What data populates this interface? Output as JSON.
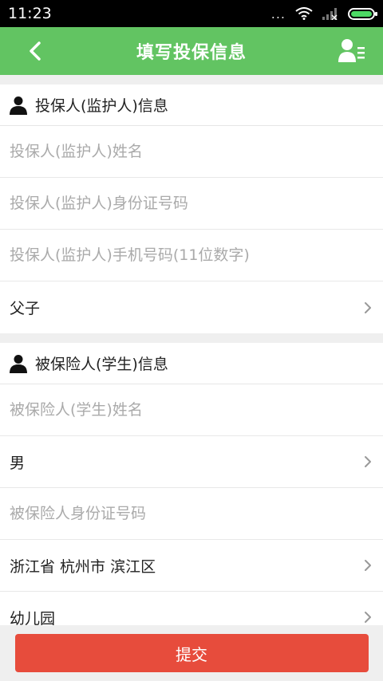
{
  "status_bar": {
    "time": "11:23",
    "dots": "...",
    "battery_level": 1.0
  },
  "nav": {
    "title": "填写投保信息"
  },
  "policyholder": {
    "title": "投保人(监护人)信息",
    "name_placeholder": "投保人(监护人)姓名",
    "id_placeholder": "投保人(监护人)身份证号码",
    "phone_placeholder": "投保人(监护人)手机号码(11位数字)",
    "relation": "父子"
  },
  "insured": {
    "title": "被保险人(学生)信息",
    "name_placeholder": "被保险人(学生)姓名",
    "gender": "男",
    "id_placeholder": "被保险人身份证号码",
    "region": "浙江省 杭州市 滨江区",
    "school_type": "幼儿园"
  },
  "footer": {
    "submit_label": "提交"
  },
  "colors": {
    "nav_green": "#62c462",
    "submit_red": "#e74c3c",
    "battery_green": "#4cd964"
  }
}
